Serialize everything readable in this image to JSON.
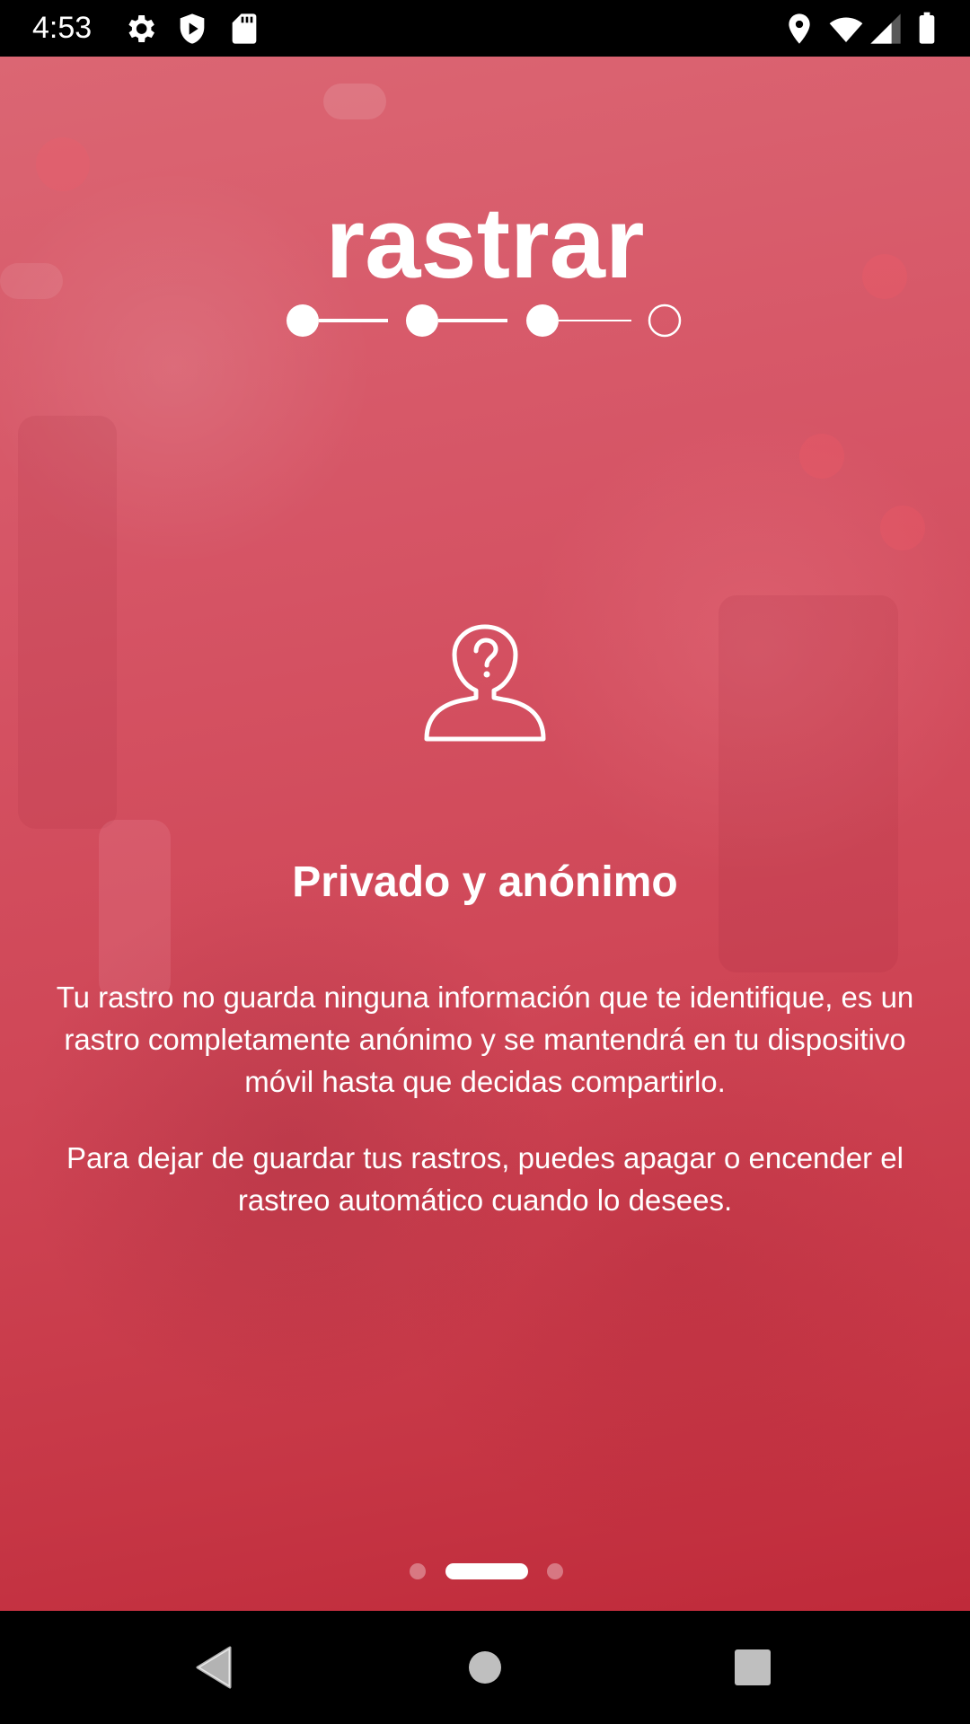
{
  "status_bar": {
    "time": "4:53",
    "left_icons": [
      "gear-icon",
      "shield-play-icon",
      "sd-card-icon"
    ],
    "right_icons": [
      "location-icon",
      "wifi-icon",
      "signal-icon",
      "battery-icon"
    ]
  },
  "logo": {
    "text": "rastrar"
  },
  "slide": {
    "icon": "anonymous-person-icon",
    "title": "Privado y anónimo",
    "paragraph_1": "Tu rastro no guarda ninguna información que te identifique, es un rastro completamente anónimo y se mantendrá en tu dispositivo móvil hasta que decidas compartirlo.",
    "paragraph_2": "Para dejar de guardar tus rastros, puedes apagar o encender el rastreo automático cuando lo desees."
  },
  "pager": {
    "pages": 3,
    "current_page": 2
  },
  "nav_bar": {
    "buttons": [
      "back-icon",
      "home-icon",
      "recents-icon"
    ]
  },
  "colors": {
    "background_top": "#db6673",
    "background_bottom": "#bf2a3a",
    "text": "#ffffff",
    "system_bar": "#000000"
  }
}
